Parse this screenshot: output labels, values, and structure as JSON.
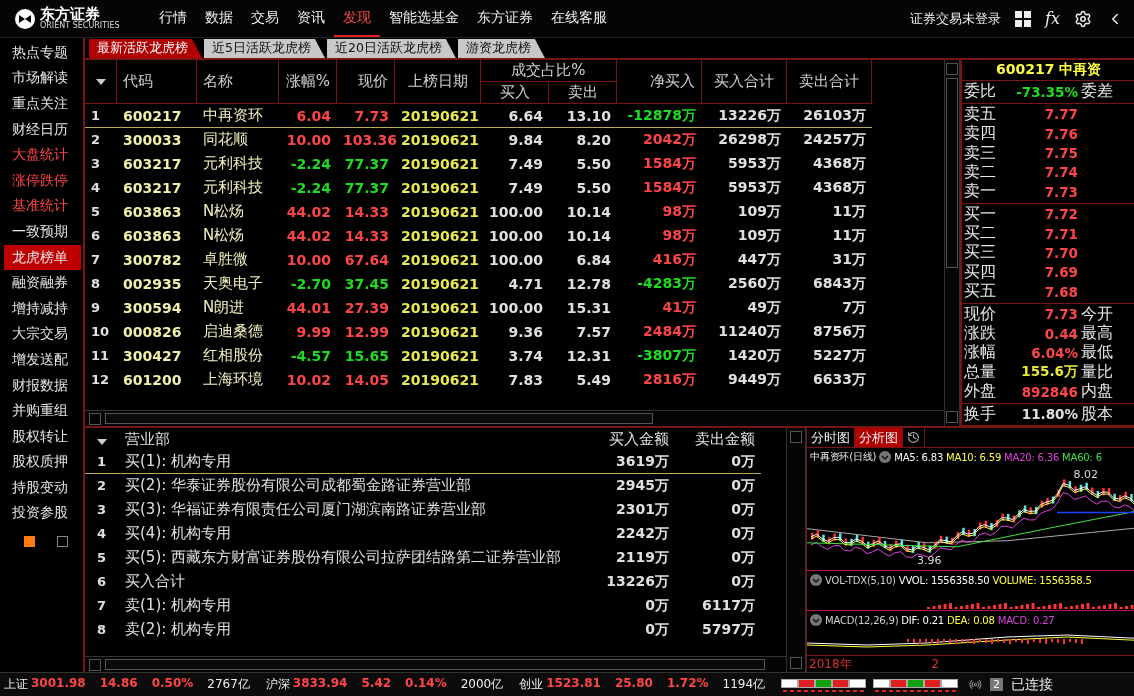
{
  "topbar": {
    "logo": {
      "name": "东方证券",
      "subtitle": "ORIENT SECURITIES"
    },
    "menu": [
      {
        "label": "行情",
        "selected": false
      },
      {
        "label": "数据",
        "selected": false
      },
      {
        "label": "交易",
        "selected": false
      },
      {
        "label": "资讯",
        "selected": false
      },
      {
        "label": "发现",
        "selected": true
      },
      {
        "label": "智能选基金",
        "selected": false
      },
      {
        "label": "东方证券",
        "selected": false
      },
      {
        "label": "在线客服",
        "selected": false
      }
    ],
    "login_status": "证券交易未登录",
    "formula_button": "fx"
  },
  "sidebar": {
    "items": [
      {
        "label": "热点专题",
        "highlight": false,
        "selected": false
      },
      {
        "label": "市场解读",
        "highlight": false,
        "selected": false
      },
      {
        "label": "重点关注",
        "highlight": false,
        "selected": false
      },
      {
        "label": "财经日历",
        "highlight": false,
        "selected": false
      },
      {
        "label": "大盘统计",
        "highlight": true,
        "selected": false
      },
      {
        "label": "涨停跌停",
        "highlight": true,
        "selected": false
      },
      {
        "label": "基准统计",
        "highlight": true,
        "selected": false
      },
      {
        "label": "一致预期",
        "highlight": false,
        "selected": false
      },
      {
        "label": "龙虎榜单",
        "highlight": false,
        "selected": true
      },
      {
        "label": "融资融券",
        "highlight": false,
        "selected": false
      },
      {
        "label": "增持减持",
        "highlight": false,
        "selected": false
      },
      {
        "label": "大宗交易",
        "highlight": false,
        "selected": false
      },
      {
        "label": "增发送配",
        "highlight": false,
        "selected": false
      },
      {
        "label": "财报数据",
        "highlight": false,
        "selected": false
      },
      {
        "label": "并购重组",
        "highlight": false,
        "selected": false
      },
      {
        "label": "股权转让",
        "highlight": false,
        "selected": false
      },
      {
        "label": "股权质押",
        "highlight": false,
        "selected": false
      },
      {
        "label": "持股变动",
        "highlight": false,
        "selected": false
      },
      {
        "label": "投资参股",
        "highlight": false,
        "selected": false
      }
    ],
    "pager": [
      {
        "selected": true
      },
      {
        "selected": false
      }
    ]
  },
  "tabs": [
    {
      "label": "最新活跃龙虎榜",
      "selected": true
    },
    {
      "label": "近5日活跃龙虎榜",
      "selected": false
    },
    {
      "label": "近20日活跃龙虎榜",
      "selected": false
    },
    {
      "label": "游资龙虎榜",
      "selected": false
    }
  ],
  "table": {
    "columns": [
      "代码",
      "名称",
      "涨幅%",
      "现价",
      "上榜日期"
    ],
    "group": {
      "label": "成交占比%",
      "columns": [
        "买入",
        "卖出"
      ]
    },
    "tail_columns": [
      "净买入",
      "买入合计",
      "卖出合计"
    ],
    "rows": [
      {
        "index": "1",
        "code": "600217",
        "name": "中再资环",
        "change": "6.04",
        "price": "7.73",
        "date": "20190621",
        "buy_pct": "6.64",
        "sell_pct": "13.10",
        "net": "-12878万",
        "buy_total": "13226万",
        "sell_total": "26103万",
        "up": true,
        "net_up": false,
        "selected": true
      },
      {
        "index": "2",
        "code": "300033",
        "name": "同花顺",
        "change": "10.00",
        "price": "103.36",
        "date": "20190621",
        "buy_pct": "9.84",
        "sell_pct": "8.20",
        "net": "2042万",
        "buy_total": "26298万",
        "sell_total": "24257万",
        "up": true,
        "net_up": true,
        "selected": false
      },
      {
        "index": "3",
        "code": "603217",
        "name": "元利科技",
        "change": "-2.24",
        "price": "77.37",
        "date": "20190621",
        "buy_pct": "7.49",
        "sell_pct": "5.50",
        "net": "1584万",
        "buy_total": "5953万",
        "sell_total": "4368万",
        "up": false,
        "net_up": true,
        "selected": false
      },
      {
        "index": "4",
        "code": "603217",
        "name": "元利科技",
        "change": "-2.24",
        "price": "77.37",
        "date": "20190621",
        "buy_pct": "7.49",
        "sell_pct": "5.50",
        "net": "1584万",
        "buy_total": "5953万",
        "sell_total": "4368万",
        "up": false,
        "net_up": true,
        "selected": false
      },
      {
        "index": "5",
        "code": "603863",
        "name": "N松炀",
        "change": "44.02",
        "price": "14.33",
        "date": "20190621",
        "buy_pct": "100.00",
        "sell_pct": "10.14",
        "net": "98万",
        "buy_total": "109万",
        "sell_total": "11万",
        "up": true,
        "net_up": true,
        "selected": false
      },
      {
        "index": "6",
        "code": "603863",
        "name": "N松炀",
        "change": "44.02",
        "price": "14.33",
        "date": "20190621",
        "buy_pct": "100.00",
        "sell_pct": "10.14",
        "net": "98万",
        "buy_total": "109万",
        "sell_total": "11万",
        "up": true,
        "net_up": true,
        "selected": false
      },
      {
        "index": "7",
        "code": "300782",
        "name": "卓胜微",
        "change": "10.00",
        "price": "67.64",
        "date": "20190621",
        "buy_pct": "100.00",
        "sell_pct": "6.84",
        "net": "416万",
        "buy_total": "447万",
        "sell_total": "31万",
        "up": true,
        "net_up": true,
        "selected": false
      },
      {
        "index": "8",
        "code": "002935",
        "name": "天奥电子",
        "change": "-2.70",
        "price": "37.45",
        "date": "20190621",
        "buy_pct": "4.71",
        "sell_pct": "12.78",
        "net": "-4283万",
        "buy_total": "2560万",
        "sell_total": "6843万",
        "up": false,
        "net_up": false,
        "selected": false
      },
      {
        "index": "9",
        "code": "300594",
        "name": "N朗进",
        "change": "44.01",
        "price": "27.39",
        "date": "20190621",
        "buy_pct": "100.00",
        "sell_pct": "15.31",
        "net": "41万",
        "buy_total": "49万",
        "sell_total": "7万",
        "up": true,
        "net_up": true,
        "selected": false
      },
      {
        "index": "10",
        "code": "000826",
        "name": "启迪桑德",
        "change": "9.99",
        "price": "12.99",
        "date": "20190621",
        "buy_pct": "9.36",
        "sell_pct": "7.57",
        "net": "2484万",
        "buy_total": "11240万",
        "sell_total": "8756万",
        "up": true,
        "net_up": true,
        "selected": false
      },
      {
        "index": "11",
        "code": "300427",
        "name": "红相股份",
        "change": "-4.57",
        "price": "15.65",
        "date": "20190621",
        "buy_pct": "3.74",
        "sell_pct": "12.31",
        "net": "-3807万",
        "buy_total": "1420万",
        "sell_total": "5227万",
        "up": false,
        "net_up": false,
        "selected": false
      },
      {
        "index": "12",
        "code": "601200",
        "name": "上海环境",
        "change": "10.02",
        "price": "14.05",
        "date": "20190621",
        "buy_pct": "7.83",
        "sell_pct": "5.49",
        "net": "2816万",
        "buy_total": "9449万",
        "sell_total": "6633万",
        "up": true,
        "net_up": true,
        "selected": false
      }
    ]
  },
  "quote": {
    "header": "600217 中再资",
    "sections": [
      [
        {
          "label": "委比",
          "value": "-73.35%",
          "color": "#1edc1e",
          "right": "委差"
        }
      ],
      [
        {
          "label": "卖五",
          "value": "7.77",
          "color": "#ff4646"
        },
        {
          "label": "卖四",
          "value": "7.76",
          "color": "#ff4646"
        },
        {
          "label": "卖三",
          "value": "7.75",
          "color": "#ff4646"
        },
        {
          "label": "卖二",
          "value": "7.74",
          "color": "#ff4646"
        },
        {
          "label": "卖一",
          "value": "7.73",
          "color": "#ff4646"
        }
      ],
      [
        {
          "label": "买一",
          "value": "7.72",
          "color": "#ff4646"
        },
        {
          "label": "买二",
          "value": "7.71",
          "color": "#ff4646"
        },
        {
          "label": "买三",
          "value": "7.70",
          "color": "#ff4646"
        },
        {
          "label": "买四",
          "value": "7.69",
          "color": "#ff4646"
        },
        {
          "label": "买五",
          "value": "7.68",
          "color": "#ff4646"
        }
      ],
      [
        {
          "label": "现价",
          "value": "7.73",
          "color": "#ff4646",
          "right": "今开"
        },
        {
          "label": "涨跌",
          "value": "0.44",
          "color": "#ff4646",
          "right": "最高"
        },
        {
          "label": "涨幅",
          "value": "6.04%",
          "color": "#ff4646",
          "right": "最低"
        },
        {
          "label": "总量",
          "value": "155.6万",
          "color": "#e6e63c",
          "right": "量比"
        },
        {
          "label": "外盘",
          "value": "892846",
          "color": "#ff4646",
          "right": "内盘"
        }
      ],
      [
        {
          "label": "换手",
          "value": "11.80%",
          "color": "#e0e0e0",
          "right": "股本"
        }
      ]
    ]
  },
  "brokers": {
    "columns": [
      "营业部",
      "买入金额",
      "卖出金额"
    ],
    "rows": [
      {
        "index": "1",
        "name": "买(1): 机构专用",
        "buy": "3619万",
        "sell": "0万",
        "selected": true
      },
      {
        "index": "2",
        "name": "买(2): 华泰证券股份有限公司成都蜀金路证券营业部",
        "buy": "2945万",
        "sell": "0万",
        "selected": false
      },
      {
        "index": "3",
        "name": "买(3): 华福证券有限责任公司厦门湖滨南路证券营业部",
        "buy": "2301万",
        "sell": "0万",
        "selected": false
      },
      {
        "index": "4",
        "name": "买(4): 机构专用",
        "buy": "2242万",
        "sell": "0万",
        "selected": false
      },
      {
        "index": "5",
        "name": "买(5): 西藏东方财富证券股份有限公司拉萨团结路第二证券营业部",
        "buy": "2119万",
        "sell": "0万",
        "selected": false
      },
      {
        "index": "6",
        "name": "买入合计",
        "buy": "13226万",
        "sell": "0万",
        "selected": false
      },
      {
        "index": "7",
        "name": "卖(1): 机构专用",
        "buy": "0万",
        "sell": "6117万",
        "selected": false
      },
      {
        "index": "8",
        "name": "卖(2): 机构专用",
        "buy": "0万",
        "sell": "5797万",
        "selected": false
      }
    ]
  },
  "chart": {
    "tabs": [
      {
        "label": "分时图",
        "selected": false
      },
      {
        "label": "分析图",
        "selected": true
      }
    ],
    "title": "中再资环(日线)",
    "ma": [
      {
        "label": "MA5: 6.83",
        "color": "#ffffff"
      },
      {
        "label": "MA10: 6.59",
        "color": "#ffff40"
      },
      {
        "label": "MA20: 6.36",
        "color": "#e040e0"
      },
      {
        "label": "MA60: 6",
        "color": "#40e040"
      }
    ],
    "high_label": "8.02",
    "low_label": "3.96",
    "vol": [
      {
        "label": "VOL-TDX(5,10)",
        "color": "#d0d0d0"
      },
      {
        "label": "VVOL: 1556358.50",
        "color": "#ffffff"
      },
      {
        "label": "VOLUME: 1556358.5",
        "color": "#ffff40"
      }
    ],
    "macd": [
      {
        "label": "MACD(12,26,9)",
        "color": "#d0d0d0"
      },
      {
        "label": "DIF: 0.21",
        "color": "#ffffff"
      },
      {
        "label": "DEA: 0.08",
        "color": "#ffff40"
      },
      {
        "label": "MACD: 0.27",
        "color": "#e040e0"
      }
    ],
    "axis": [
      "2018年",
      "2"
    ]
  },
  "status_bar": {
    "indices": [
      {
        "name": "上证",
        "value": "3001.98",
        "change": "14.86",
        "pct": "0.50%",
        "amount": "2767亿",
        "up": true
      },
      {
        "name": "沪深",
        "value": "3833.94",
        "change": "5.42",
        "pct": "0.14%",
        "amount": "2000亿",
        "up": true
      },
      {
        "name": "创业",
        "value": "1523.81",
        "change": "25.80",
        "pct": "1.72%",
        "amount": "1194亿",
        "up": true
      }
    ],
    "connections": "2",
    "connection_status": "已连接"
  }
}
